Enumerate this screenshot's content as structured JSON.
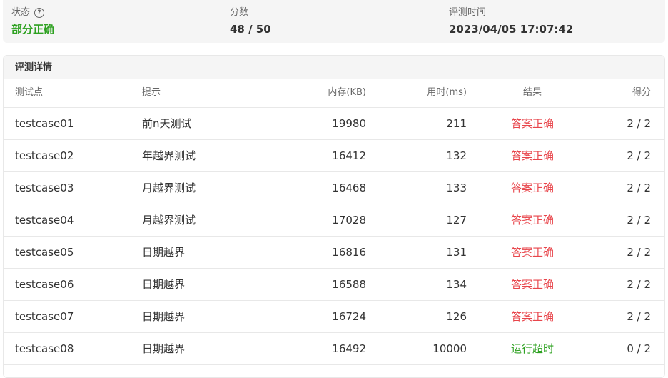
{
  "summary": {
    "status_label": "状态",
    "status_value": "部分正确",
    "score_label": "分数",
    "score_value": "48 / 50",
    "time_label": "评测时间",
    "time_value": "2023/04/05 17:07:42",
    "help_icon": "question-circle-icon"
  },
  "details": {
    "title": "评测详情",
    "columns": {
      "case": "测试点",
      "hint": "提示",
      "memory": "内存(KB)",
      "time": "用时(ms)",
      "result": "结果",
      "score": "得分"
    },
    "rows": [
      {
        "case": "testcase01",
        "hint": "前n天测试",
        "memory": "19980",
        "time": "211",
        "result": "答案正确",
        "score": "2 / 2"
      },
      {
        "case": "testcase02",
        "hint": "年越界测试",
        "memory": "16412",
        "time": "132",
        "result": "答案正确",
        "score": "2 / 2"
      },
      {
        "case": "testcase03",
        "hint": "月越界测试",
        "memory": "16468",
        "time": "133",
        "result": "答案正确",
        "score": "2 / 2"
      },
      {
        "case": "testcase04",
        "hint": "月越界测试",
        "memory": "17028",
        "time": "127",
        "result": "答案正确",
        "score": "2 / 2"
      },
      {
        "case": "testcase05",
        "hint": "日期越界",
        "memory": "16816",
        "time": "131",
        "result": "答案正确",
        "score": "2 / 2"
      },
      {
        "case": "testcase06",
        "hint": "日期越界",
        "memory": "16588",
        "time": "134",
        "result": "答案正确",
        "score": "2 / 2"
      },
      {
        "case": "testcase07",
        "hint": "日期越界",
        "memory": "16724",
        "time": "126",
        "result": "答案正确",
        "score": "2 / 2"
      },
      {
        "case": "testcase08",
        "hint": "日期越界",
        "memory": "16492",
        "time": "10000",
        "result": "运行超时",
        "score": "0 / 2"
      }
    ]
  },
  "colors": {
    "accepted": "#e8454b",
    "time_limit_exceeded": "#2ea121",
    "partial_status": "#2ea121"
  }
}
